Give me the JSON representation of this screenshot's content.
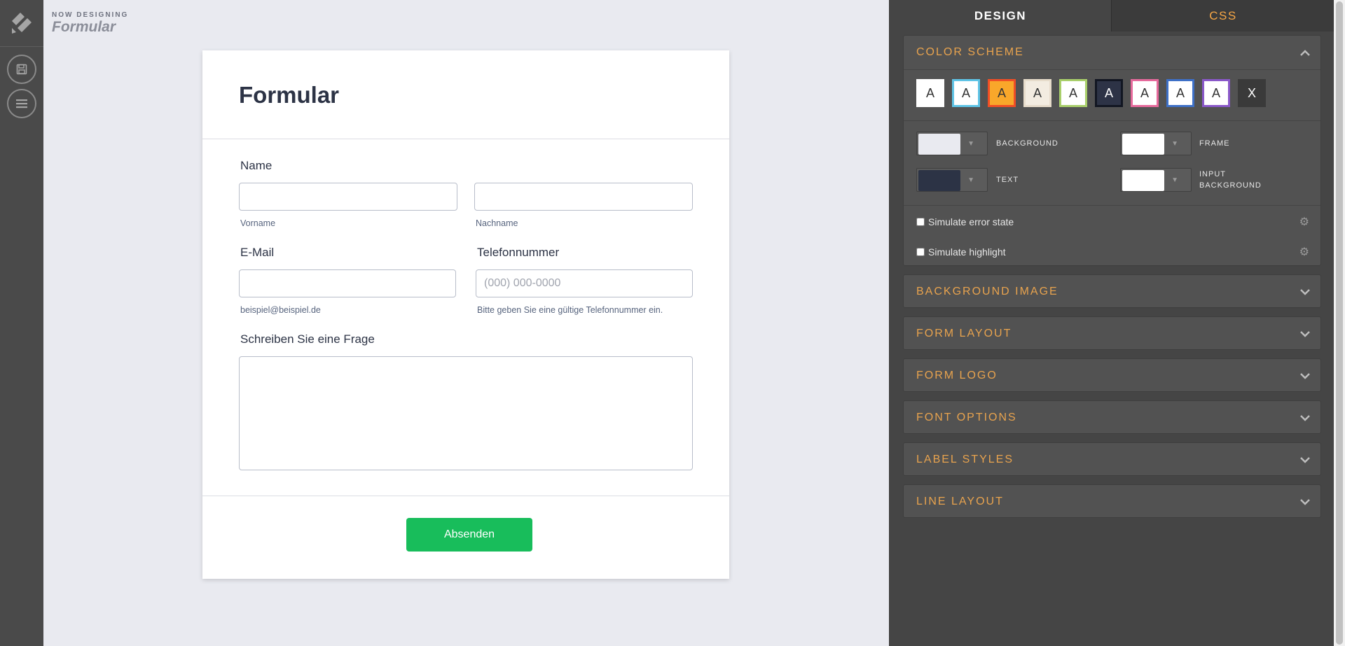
{
  "header": {
    "now_label": "NOW DESIGNING",
    "title": "Formular"
  },
  "sidebar": {
    "buttons": [
      {
        "name": "save",
        "icon": "floppy-disk-icon"
      },
      {
        "name": "menu",
        "icon": "hamburger-menu-icon"
      }
    ]
  },
  "form": {
    "title": "Formular",
    "name_label": "Name",
    "first_sublabel": "Vorname",
    "last_sublabel": "Nachname",
    "email_label": "E-Mail",
    "email_sublabel": "beispiel@beispiel.de",
    "phone_label": "Telefonnummer",
    "phone_placeholder": "(000) 000-0000",
    "phone_sublabel": "Bitte geben Sie eine gültige Telefonnummer ein.",
    "question_label": "Schreiben Sie eine Frage",
    "submit_label": "Absenden",
    "submit_color": "#18bd5b"
  },
  "panel": {
    "tabs": {
      "design": "DESIGN",
      "css": "CSS"
    },
    "color_scheme": {
      "title": "COLOR SCHEME",
      "swatches": [
        {
          "label": "A",
          "bg": "#ffffff",
          "border": "#ffffff",
          "text": "#333333"
        },
        {
          "label": "A",
          "bg": "#ffffff",
          "border": "#5fc4e6",
          "text": "#333333"
        },
        {
          "label": "A",
          "bg": "#f9a72a",
          "border": "#f04e26",
          "text": "#333333"
        },
        {
          "label": "A",
          "bg": "#f3ece1",
          "border": "#e7dccb",
          "text": "#333333"
        },
        {
          "label": "A",
          "bg": "#ffffff",
          "border": "#a9cf6b",
          "text": "#333333"
        },
        {
          "label": "A",
          "bg": "#2d3346",
          "border": "#121622",
          "text": "#ffffff"
        },
        {
          "label": "A",
          "bg": "#ffffff",
          "border": "#e66a9c",
          "text": "#333333"
        },
        {
          "label": "A",
          "bg": "#ffffff",
          "border": "#3e70c7",
          "text": "#333333"
        },
        {
          "label": "A",
          "bg": "#ffffff",
          "border": "#8a58c9",
          "text": "#333333"
        },
        {
          "label": "X",
          "bg": "#3a3a3a",
          "border": "#3a3a3a",
          "text": "#ffffff"
        }
      ],
      "background_label": "BACKGROUND",
      "background_color": "#e9eaf0",
      "frame_label": "FRAME",
      "frame_color": "#ffffff",
      "text_label": "TEXT",
      "text_color": "#2c3345",
      "input_bg_label_1": "INPUT",
      "input_bg_label_2": "BACKGROUND",
      "input_bg_color": "#ffffff",
      "sim_error": "Simulate error state",
      "sim_highlight": "Simulate highlight"
    },
    "sections": [
      "BACKGROUND IMAGE",
      "FORM LAYOUT",
      "FORM LOGO",
      "FONT OPTIONS",
      "LABEL STYLES",
      "LINE LAYOUT"
    ],
    "accent_color": "#e8a34e"
  }
}
